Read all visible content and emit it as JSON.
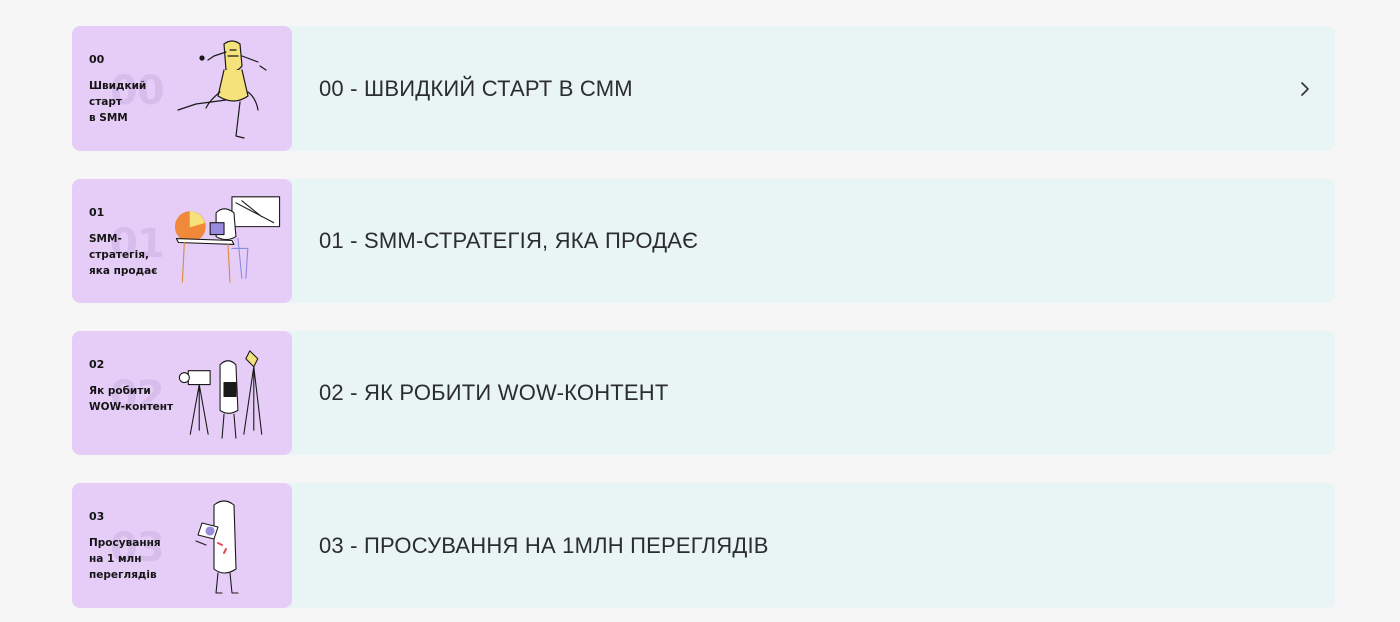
{
  "lessons": [
    {
      "number": "00",
      "ghost": "00",
      "caption": "Швидкий\nстарт\nв SMM",
      "title": "00 - ШВИДКИЙ СТАРТ В СММ",
      "has_chevron": true,
      "chevron_icon": "chevron-right-icon"
    },
    {
      "number": "01",
      "ghost": "01",
      "caption": "SMM-\nстратегія,\nяка продає",
      "title": "01 - SMM-СТРАТЕГІЯ, ЯКА ПРОДАЄ",
      "has_chevron": false
    },
    {
      "number": "02",
      "ghost": "02",
      "caption": "Як робити\nWOW-контент",
      "title": "02 - ЯК РОБИТИ WOW-КОНТЕНТ",
      "has_chevron": false
    },
    {
      "number": "03",
      "ghost": "03",
      "caption": "Просування\nна 1 млн\nпереглядів",
      "title": "03 - ПРОСУВАННЯ НА 1МЛН ПЕРЕГЛЯДІВ",
      "has_chevron": false
    }
  ],
  "colors": {
    "page_bg": "#f6f6f6",
    "card_bg": "#e9f4f5",
    "thumb_bg": "#e5cdf7",
    "accent_yellow": "#f6e27a",
    "accent_orange": "#f08a3a"
  }
}
